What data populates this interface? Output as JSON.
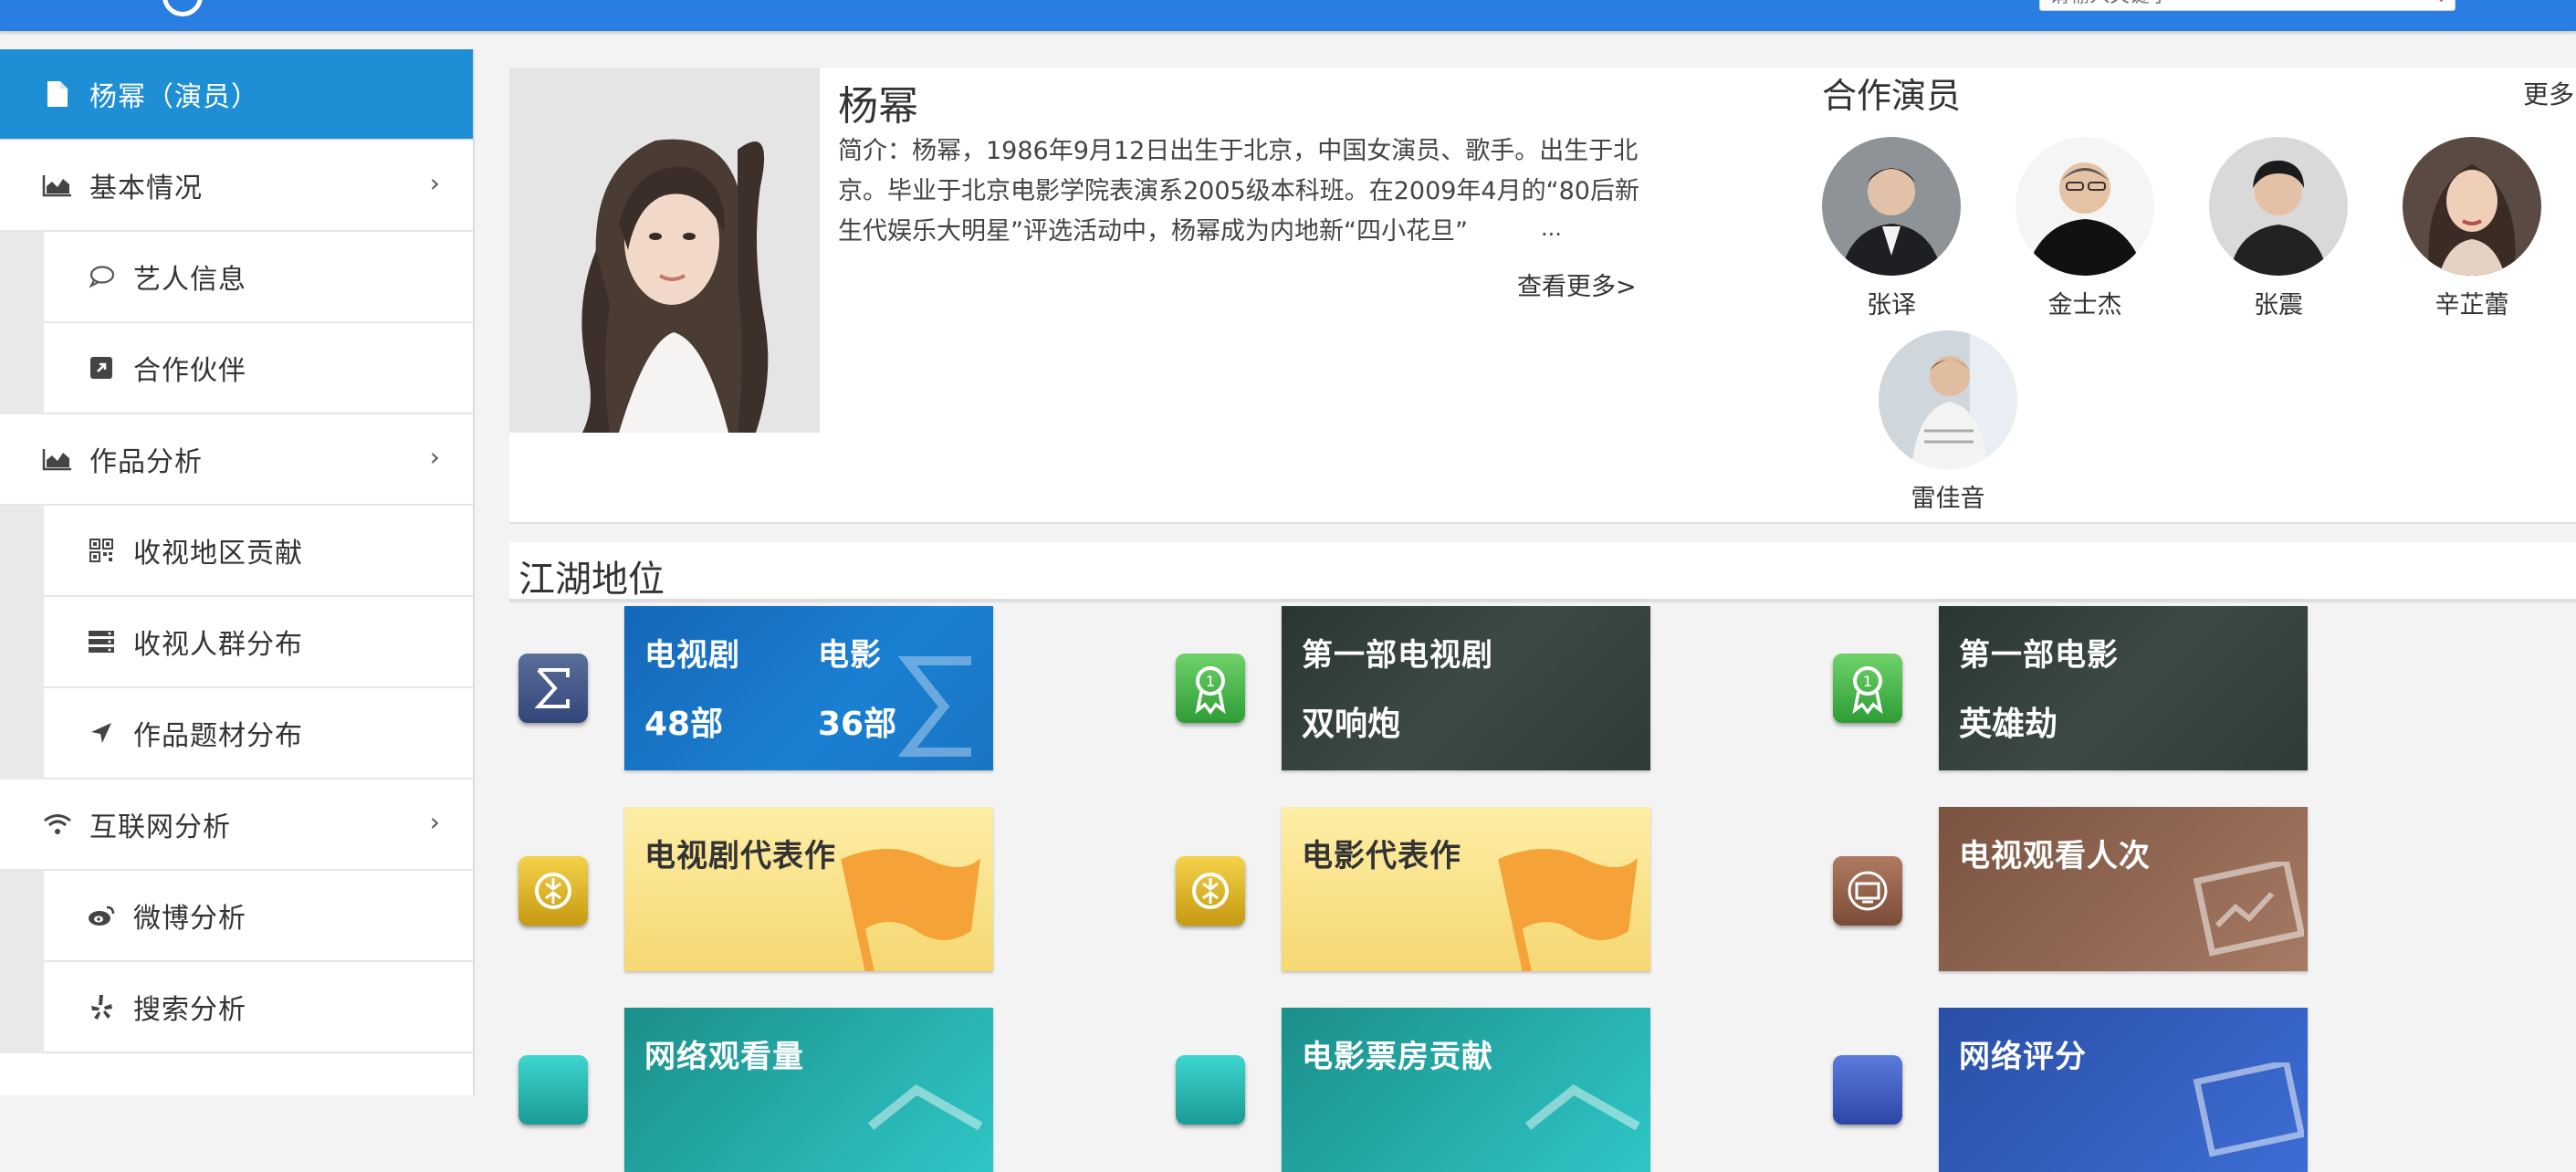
{
  "search": {
    "placeholder": "请输入关键字"
  },
  "sidebar": {
    "items": [
      {
        "label": "杨幂（演员）",
        "icon": "file-icon",
        "active": true
      },
      {
        "label": "基本情况",
        "icon": "area-chart-icon",
        "chevron": "›"
      },
      {
        "label": "艺人信息",
        "icon": "comment-icon"
      },
      {
        "label": "合作伙伴",
        "icon": "external-link-icon"
      },
      {
        "label": "作品分析",
        "icon": "area-chart-icon",
        "chevron": "›"
      },
      {
        "label": "收视地区贡献",
        "icon": "qrcode-icon"
      },
      {
        "label": "收视人群分布",
        "icon": "server-icon"
      },
      {
        "label": "作品题材分布",
        "icon": "location-arrow-icon"
      },
      {
        "label": "互联网分析",
        "icon": "wifi-icon",
        "chevron": "›"
      },
      {
        "label": "微博分析",
        "icon": "weibo-icon"
      },
      {
        "label": "搜索分析",
        "icon": "yelp-icon"
      }
    ]
  },
  "profile": {
    "name": "杨幂",
    "bio": "简介：杨幂，1986年9月12日出生于北京，中国女演员、歌手。出生于北京。毕业于北京电影学院表演系2005级本科班。在2009年4月的“80后新生代娱乐大明星”评选活动中，杨幂成为内地新“四小花旦”",
    "ellipsis": "...",
    "more_label": "查看更多>"
  },
  "coactors": {
    "title": "合作演员",
    "more": "更多",
    "list": [
      {
        "name": "张译"
      },
      {
        "name": "金士杰"
      },
      {
        "name": "张震"
      },
      {
        "name": "辛芷蕾"
      },
      {
        "name": "雷佳音"
      }
    ]
  },
  "status": {
    "title": "江湖地位",
    "tiles": [
      {
        "icon": "sigma-icon",
        "theme": "blue",
        "label1": "电视剧",
        "value1": "48部",
        "label2": "电影",
        "value2": "36部"
      },
      {
        "icon": "award-icon",
        "theme": "dark",
        "title": "第一部电视剧",
        "value": "双响炮"
      },
      {
        "icon": "award-icon",
        "theme": "dark",
        "title": "第一部电影",
        "value": "英雄劫"
      },
      {
        "icon": "rotate-icon",
        "theme": "yellow",
        "title": "电视剧代表作"
      },
      {
        "icon": "rotate-icon",
        "theme": "yellow",
        "title": "电影代表作"
      },
      {
        "icon": "tv-icon",
        "theme": "brown",
        "title": "电视观看人次"
      },
      {
        "icon": "monitor-icon",
        "theme": "teal",
        "title": "网络观看量"
      },
      {
        "icon": "monitor-icon",
        "theme": "teal",
        "title": "电影票房贡献"
      },
      {
        "icon": "globe-icon",
        "theme": "navy",
        "title": "网络评分"
      }
    ]
  },
  "colors": {
    "topbar": "#2a7de1",
    "sidebar_active": "#1e8fd5"
  }
}
